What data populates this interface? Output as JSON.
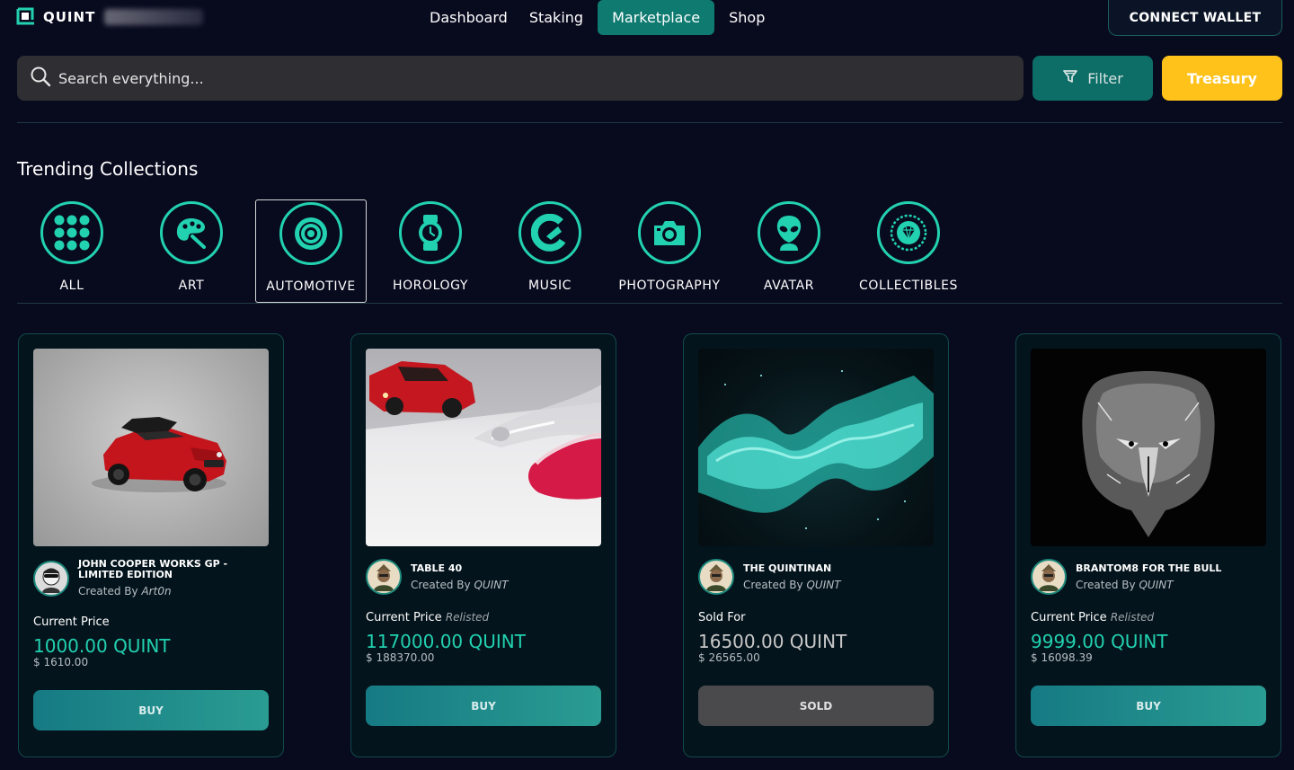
{
  "header": {
    "logo_text": "QUINT",
    "nav": [
      "Dashboard",
      "Staking",
      "Marketplace",
      "Shop"
    ],
    "active_nav": "Marketplace",
    "connect_label": "CONNECT WALLET"
  },
  "search": {
    "placeholder": "Search everything..."
  },
  "filter_label": "Filter",
  "treasury_label": "Treasury",
  "section_title": "Trending Collections",
  "categories": [
    {
      "label": "ALL",
      "icon": "grid-dots-icon"
    },
    {
      "label": "ART",
      "icon": "palette-icon"
    },
    {
      "label": "AUTOMOTIVE",
      "icon": "tire-icon"
    },
    {
      "label": "HOROLOGY",
      "icon": "watch-icon"
    },
    {
      "label": "MUSIC",
      "icon": "music-icon"
    },
    {
      "label": "PHOTOGRAPHY",
      "icon": "camera-icon"
    },
    {
      "label": "AVATAR",
      "icon": "alien-icon"
    },
    {
      "label": "COLLECTIBLES",
      "icon": "diamond-emblem-icon"
    }
  ],
  "active_category": "AUTOMOTIVE",
  "cards": [
    {
      "title": "JOHN COOPER WORKS GP - LIMITED EDITION",
      "created_by": "Created By",
      "creator": "Art0n",
      "price_label": "Current Price",
      "tag": "",
      "price": "1000.00 QUINT",
      "usd": "$ 1610.00",
      "button": "BUY"
    },
    {
      "title": "TABLE 40",
      "created_by": "Created By",
      "creator": "QUINT",
      "price_label": "Current Price",
      "tag": "Relisted",
      "price": "117000.00 QUINT",
      "usd": "$ 188370.00",
      "button": "BUY"
    },
    {
      "title": "THE QUINTINAN",
      "created_by": "Created By",
      "creator": "QUINT",
      "price_label": "Sold For",
      "tag": "",
      "price": "16500.00 QUINT",
      "usd": "$ 26565.00",
      "button": "SOLD"
    },
    {
      "title": "BRANTOM8 FOR THE BULL",
      "created_by": "Created By",
      "creator": "QUINT",
      "price_label": "Current Price",
      "tag": "Relisted",
      "price": "9999.00 QUINT",
      "usd": "$ 16098.39",
      "button": "BUY"
    }
  ],
  "colors": {
    "accent": "#22d1b0",
    "teal": "#0e7a70",
    "treasury": "#ffc21a",
    "background": "#080a1e"
  }
}
